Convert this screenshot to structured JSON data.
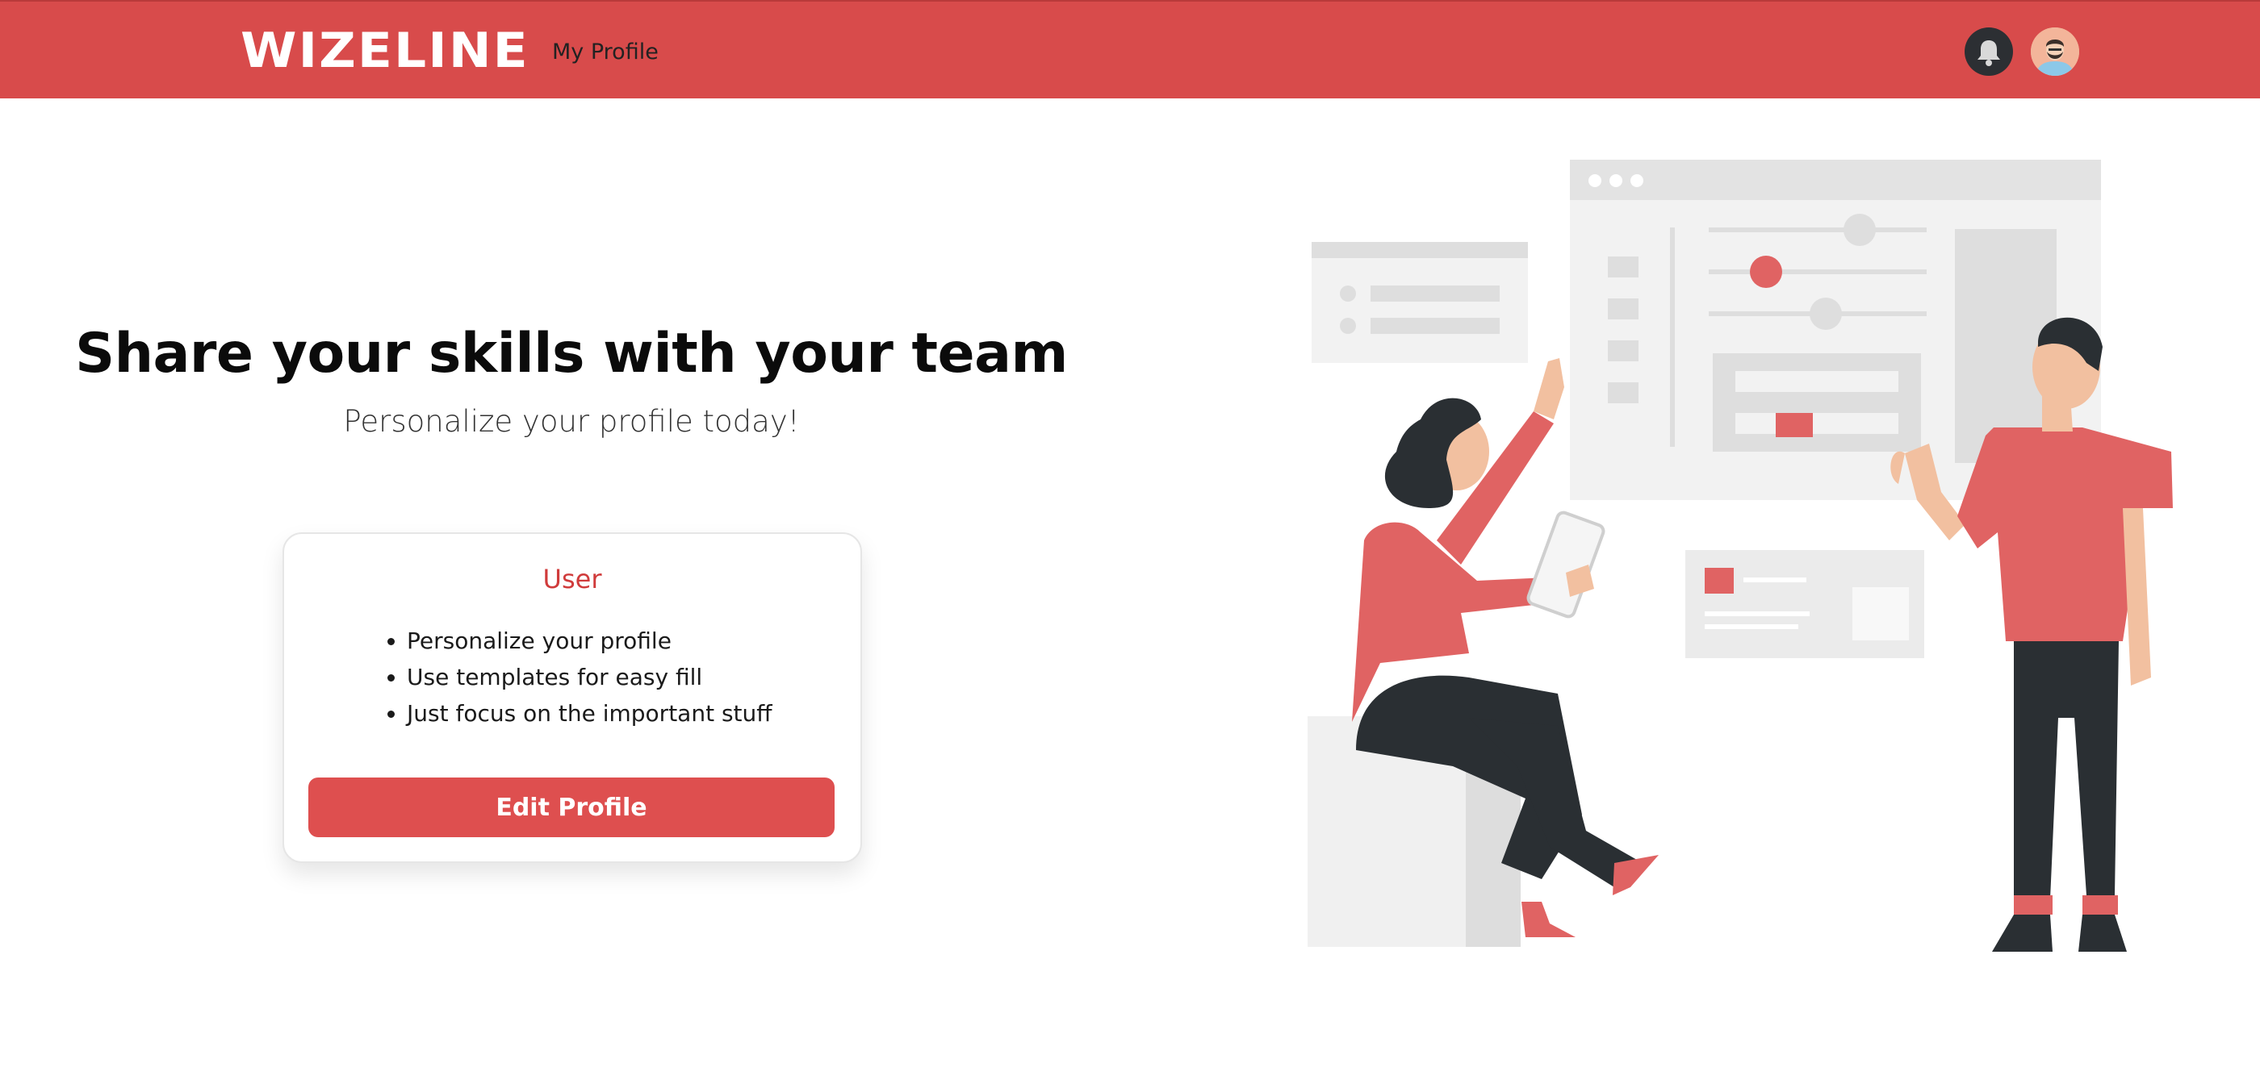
{
  "navbar": {
    "brand": "WIZELINE",
    "my_profile_link": "My Profile",
    "icons": [
      "bell-icon",
      "user-avatar"
    ],
    "background_color": "#d84b4b"
  },
  "hero": {
    "title": "Share your skills with your team",
    "subtitle": "Personalize your profile today!"
  },
  "card": {
    "title": "User",
    "features": [
      "Personalize your profile",
      "Use templates for easy fill",
      "Just focus on the important stuff"
    ],
    "button_label": "Edit Profile",
    "accent_color": "#de4f4f"
  },
  "illustration": {
    "description_icon": "team-collaboration-illustration",
    "colors": {
      "red": "#e06363",
      "dark": "#2a2f33",
      "gray": "#ebebeb"
    }
  }
}
